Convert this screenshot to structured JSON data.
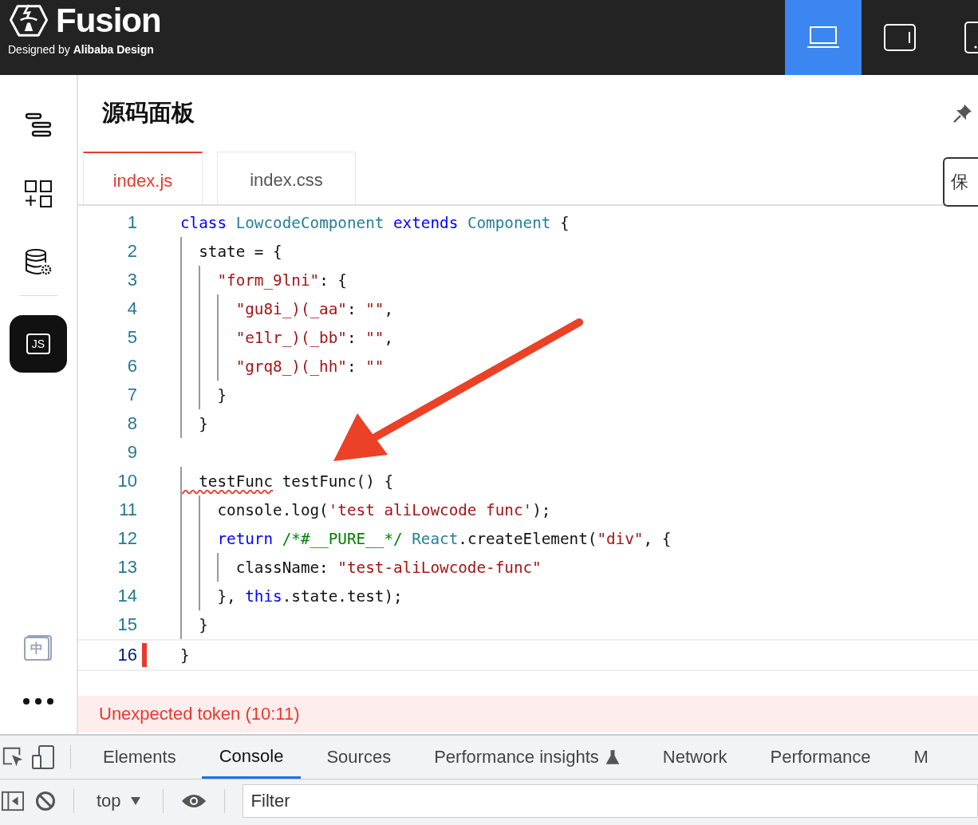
{
  "header": {
    "logo_title": "Fusion",
    "logo_subtitle": "Designed by **Alibaba Design**",
    "devices": [
      {
        "kind": "desktop",
        "selected": true
      },
      {
        "kind": "tablet",
        "selected": false
      },
      {
        "kind": "phone",
        "selected": false
      }
    ]
  },
  "sidebar": {
    "items": [
      {
        "kind": "outline",
        "selected": false
      },
      {
        "kind": "components",
        "selected": false
      },
      {
        "kind": "datasource",
        "selected": false
      },
      {
        "kind": "js",
        "label": "JS",
        "selected": true
      }
    ],
    "bottom": [
      {
        "kind": "lang",
        "label": "中"
      },
      {
        "kind": "more"
      }
    ]
  },
  "panel": {
    "title": "源码面板",
    "save_button": "保",
    "tabs": [
      {
        "label": "index.js",
        "selected": true
      },
      {
        "label": "index.css",
        "selected": false
      }
    ],
    "lines": [
      {
        "number": "1",
        "current": false,
        "tokens": [
          {
            "kind": "keyword",
            "text": "class "
          },
          {
            "kind": "type",
            "text": "LowcodeComponent "
          },
          {
            "kind": "keyword",
            "text": "extends "
          },
          {
            "kind": "type",
            "text": "Component "
          },
          {
            "kind": "plain",
            "text": "{"
          }
        ]
      },
      {
        "number": "2",
        "current": false,
        "tokens": [
          {
            "kind": "plain",
            "text": "  state = {"
          }
        ]
      },
      {
        "number": "3",
        "current": false,
        "tokens": [
          {
            "kind": "string",
            "text": "    \"form_9lni\""
          },
          {
            "kind": "plain",
            "text": ": {"
          }
        ]
      },
      {
        "number": "4",
        "current": false,
        "tokens": [
          {
            "kind": "string",
            "text": "      \"gu8i_)(_aa\""
          },
          {
            "kind": "plain",
            "text": ": "
          },
          {
            "kind": "string",
            "text": "\"\""
          },
          {
            "kind": "plain",
            "text": ","
          }
        ]
      },
      {
        "number": "5",
        "current": false,
        "tokens": [
          {
            "kind": "string",
            "text": "      \"e1lr_)(_bb\""
          },
          {
            "kind": "plain",
            "text": ": "
          },
          {
            "kind": "string",
            "text": "\"\""
          },
          {
            "kind": "plain",
            "text": ","
          }
        ]
      },
      {
        "number": "6",
        "current": false,
        "tokens": [
          {
            "kind": "string",
            "text": "      \"grq8_)(_hh\""
          },
          {
            "kind": "plain",
            "text": ": "
          },
          {
            "kind": "string",
            "text": "\"\""
          }
        ]
      },
      {
        "number": "7",
        "current": false,
        "tokens": [
          {
            "kind": "plain",
            "text": "    }"
          }
        ]
      },
      {
        "number": "8",
        "current": false,
        "tokens": [
          {
            "kind": "plain",
            "text": "  }"
          }
        ]
      },
      {
        "number": "9",
        "current": false
      },
      {
        "number": "10",
        "current": false,
        "tokens": [
          {
            "kind": "error",
            "text": "  testFunc"
          },
          {
            "kind": "plain",
            "text": " testFunc() {"
          }
        ]
      },
      {
        "number": "11",
        "current": false,
        "tokens": [
          {
            "kind": "plain",
            "text": "    console.log("
          },
          {
            "kind": "string",
            "text": "'test aliLowcode func'"
          },
          {
            "kind": "plain",
            "text": ");"
          }
        ]
      },
      {
        "number": "12",
        "current": false,
        "tokens": [
          {
            "kind": "keyword",
            "text": "    return "
          },
          {
            "kind": "comment",
            "text": "/*#__PURE__*/ "
          },
          {
            "kind": "type",
            "text": "React"
          },
          {
            "kind": "plain",
            "text": ".createElement("
          },
          {
            "kind": "string",
            "text": "\"div\""
          },
          {
            "kind": "plain",
            "text": ", {"
          }
        ]
      },
      {
        "number": "13",
        "current": false,
        "tokens": [
          {
            "kind": "plain",
            "text": "      className: "
          },
          {
            "kind": "string",
            "text": "\"test-aliLowcode-func\""
          }
        ]
      },
      {
        "number": "14",
        "current": false,
        "tokens": [
          {
            "kind": "plain",
            "text": "    }, "
          },
          {
            "kind": "keyword",
            "text": "this"
          },
          {
            "kind": "plain",
            "text": ".state.test);"
          }
        ]
      },
      {
        "number": "15",
        "current": false,
        "tokens": [
          {
            "kind": "plain",
            "text": "  }"
          }
        ]
      },
      {
        "number": "16",
        "current": true,
        "tokens": [
          {
            "kind": "plain",
            "text": "}"
          }
        ]
      }
    ],
    "error": "Unexpected token (10:11)"
  },
  "devtools": {
    "tabs": [
      {
        "label": "Elements",
        "selected": false
      },
      {
        "label": "Console",
        "selected": true
      },
      {
        "label": "Sources",
        "selected": false
      },
      {
        "label": "Performance insights",
        "selected": false,
        "experimental": true
      },
      {
        "label": "Network",
        "selected": false
      },
      {
        "label": "Performance",
        "selected": false
      },
      {
        "label": "M",
        "selected": false
      }
    ],
    "context": "top",
    "filter_placeholder": "Filter"
  }
}
